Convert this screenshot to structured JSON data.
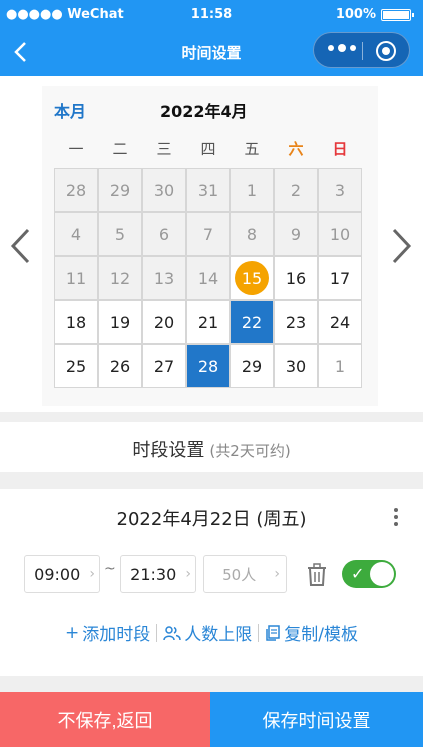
{
  "status": {
    "carrier": "●●●●● WeChat",
    "time": "11:58",
    "battery": "100%"
  },
  "nav": {
    "title": "时间设置"
  },
  "calendar": {
    "this_month": "本月",
    "title": "2022年4月",
    "weekdays": [
      "一",
      "二",
      "三",
      "四",
      "五",
      "六",
      "日"
    ],
    "weeks": [
      [
        "28",
        "29",
        "30",
        "31",
        "1",
        "2",
        "3"
      ],
      [
        "4",
        "5",
        "6",
        "7",
        "8",
        "9",
        "10"
      ],
      [
        "11",
        "12",
        "13",
        "14",
        "15",
        "16",
        "17"
      ],
      [
        "18",
        "19",
        "20",
        "21",
        "22",
        "23",
        "24"
      ],
      [
        "25",
        "26",
        "27",
        "28",
        "29",
        "30",
        "1"
      ]
    ],
    "today": "15",
    "selected": [
      "22",
      "28"
    ]
  },
  "slots": {
    "title": "时段设置",
    "subtitle": "(共2天可约)",
    "date": "2022年4月22日 (周五)",
    "start": "09:00",
    "end": "21:30",
    "tilde": "~",
    "people": "50人",
    "add_label": "添加时段",
    "limit_label": "人数上限",
    "copy_label": "复制/模板",
    "enabled": true
  },
  "buttons": {
    "cancel": "不保存,返回",
    "save": "保存时间设置"
  },
  "colors": {
    "primary": "#2196f3",
    "today": "#f5a300",
    "selected": "#2177c9",
    "cancel": "#f76767",
    "toggle_on": "#3dab3d"
  }
}
